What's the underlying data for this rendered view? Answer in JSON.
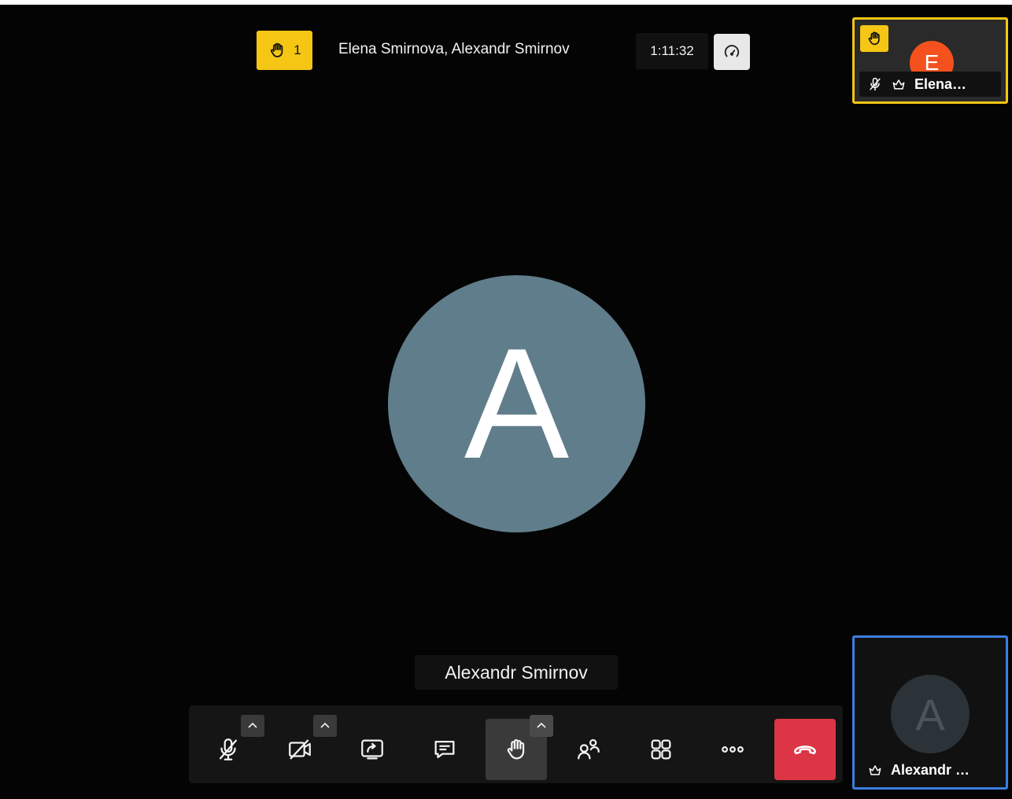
{
  "header": {
    "raised_hands_count": "1",
    "participants_title": "Elena Smirnova, Alexandr Smirnov",
    "timer": "1:11:32",
    "hand_icon": "raised-hand-icon",
    "perf_icon": "performance-gauge-icon"
  },
  "main": {
    "avatar_letter": "A",
    "avatar_color": "#607d8b",
    "speaker_name": "Alexandr Smirnov"
  },
  "toolbar": {
    "buttons": [
      {
        "icon": "microphone-muted-icon",
        "has_menu": true
      },
      {
        "icon": "camera-off-icon",
        "has_menu": true
      },
      {
        "icon": "share-screen-icon",
        "has_menu": false
      },
      {
        "icon": "chat-icon",
        "has_menu": false
      },
      {
        "icon": "raise-hand-icon",
        "has_menu": true,
        "active": true
      },
      {
        "icon": "participants-icon",
        "has_menu": false
      },
      {
        "icon": "tile-view-icon",
        "has_menu": false
      },
      {
        "icon": "more-options-icon",
        "has_menu": false
      },
      {
        "icon": "hang-up-icon",
        "has_menu": false,
        "color": "#dc3545"
      }
    ]
  },
  "tiles": {
    "elena": {
      "avatar_letter": "E",
      "avatar_color": "#f4511e",
      "name": "Elena Smirnova",
      "name_display": "Elena…",
      "border_color": "#f5c614",
      "hand_raised": true,
      "muted": true,
      "moderator": true
    },
    "alexandr": {
      "avatar_letter": "A",
      "name": "Alexandr Smirnov",
      "name_display": "Alexandr …",
      "border_color": "#3c7fe0",
      "moderator": true
    }
  }
}
